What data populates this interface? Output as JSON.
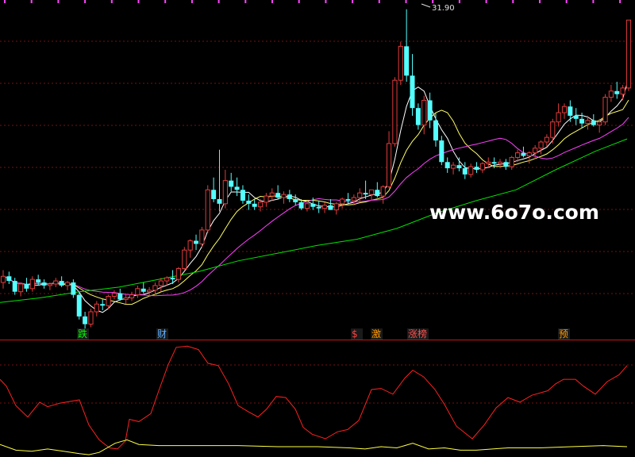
{
  "watermark": "www.6o7o.com",
  "colors": {
    "background": "#000000",
    "grid": "#7a1010",
    "separator": "#c01818",
    "up": "#e03c3c",
    "down": "#54ffff",
    "ma5": "#ffffff",
    "ma10": "#ffff66",
    "ma20": "#ff40ff",
    "ma60": "#00e400",
    "osc_red": "#ff2020",
    "osc_yellow": "#ffff40",
    "top_marks": "#ff44ff"
  },
  "tags": [
    {
      "id": "die",
      "text": "跌",
      "color": "#00ff00"
    },
    {
      "id": "cai",
      "text": "财",
      "color": "#60b0ff"
    },
    {
      "id": "dollar",
      "text": "$",
      "color": "#ff4040"
    },
    {
      "id": "ji",
      "text": "激",
      "color": "#ff9900"
    },
    {
      "id": "zhangbang",
      "text": "涨榜",
      "color": "#ff5050"
    },
    {
      "id": "yu",
      "text": "预",
      "color": "#ff9900"
    }
  ],
  "chart_data": [
    {
      "type": "candlestick",
      "title": "",
      "high_label": "31.90",
      "grid": true,
      "ylim": [
        10.5,
        32.5
      ],
      "candles": [
        [
          14.2,
          15.0,
          13.8,
          14.6
        ],
        [
          14.6,
          14.9,
          14.1,
          14.3
        ],
        [
          14.3,
          14.5,
          13.4,
          13.6
        ],
        [
          13.6,
          14.2,
          13.3,
          14.1
        ],
        [
          14.1,
          14.5,
          13.6,
          13.8
        ],
        [
          13.8,
          14.6,
          13.6,
          14.4
        ],
        [
          14.4,
          14.7,
          14.0,
          14.2
        ],
        [
          14.2,
          14.4,
          13.8,
          14.0
        ],
        [
          14.0,
          14.2,
          13.7,
          14.1
        ],
        [
          14.1,
          14.5,
          13.9,
          14.3
        ],
        [
          14.3,
          14.6,
          13.9,
          14.0
        ],
        [
          14.0,
          14.3,
          13.7,
          14.2
        ],
        [
          14.2,
          14.4,
          13.2,
          13.4
        ],
        [
          13.4,
          13.6,
          11.8,
          12.0
        ],
        [
          12.0,
          12.3,
          11.0,
          11.5
        ],
        [
          11.5,
          12.5,
          11.3,
          12.3
        ],
        [
          12.3,
          13.0,
          12.0,
          12.8
        ],
        [
          12.8,
          13.1,
          12.4,
          12.7
        ],
        [
          12.7,
          13.4,
          12.5,
          13.3
        ],
        [
          13.3,
          13.7,
          13.1,
          13.5
        ],
        [
          13.5,
          13.8,
          13.0,
          13.1
        ],
        [
          13.1,
          13.5,
          12.8,
          13.2
        ],
        [
          13.2,
          13.6,
          13.0,
          13.4
        ],
        [
          13.4,
          14.0,
          13.2,
          13.8
        ],
        [
          13.8,
          14.2,
          13.5,
          13.6
        ],
        [
          13.6,
          13.9,
          13.3,
          13.7
        ],
        [
          13.7,
          14.2,
          13.4,
          14.0
        ],
        [
          14.0,
          14.5,
          13.6,
          14.3
        ],
        [
          14.3,
          14.6,
          14.0,
          14.5
        ],
        [
          14.5,
          15.0,
          14.1,
          14.4
        ],
        [
          14.4,
          15.2,
          14.2,
          15.1
        ],
        [
          15.1,
          16.5,
          15.0,
          16.3
        ],
        [
          16.3,
          17.0,
          15.8,
          16.9
        ],
        [
          16.9,
          17.3,
          16.3,
          16.7
        ],
        [
          16.7,
          17.8,
          16.5,
          17.6
        ],
        [
          17.6,
          20.5,
          17.4,
          20.2
        ],
        [
          20.2,
          21.0,
          19.4,
          19.6
        ],
        [
          19.6,
          22.8,
          18.8,
          19.3
        ],
        [
          19.3,
          21.5,
          19.0,
          20.8
        ],
        [
          20.8,
          21.3,
          20.1,
          20.4
        ],
        [
          20.4,
          21.0,
          19.8,
          20.2
        ],
        [
          20.2,
          20.5,
          19.3,
          19.5
        ],
        [
          19.5,
          19.9,
          18.9,
          19.3
        ],
        [
          19.3,
          19.6,
          18.9,
          19.1
        ],
        [
          19.1,
          19.6,
          18.8,
          19.4
        ],
        [
          19.4,
          20.0,
          19.1,
          19.8
        ],
        [
          19.8,
          20.3,
          19.5,
          20.0
        ],
        [
          20.0,
          20.5,
          19.6,
          19.7
        ],
        [
          19.7,
          20.1,
          19.3,
          19.9
        ],
        [
          19.9,
          20.2,
          19.4,
          19.6
        ],
        [
          19.6,
          19.9,
          19.2,
          19.4
        ],
        [
          19.4,
          19.6,
          18.9,
          19.0
        ],
        [
          19.0,
          19.4,
          18.8,
          19.3
        ],
        [
          19.3,
          19.7,
          18.9,
          19.1
        ],
        [
          19.1,
          19.5,
          18.7,
          19.0
        ],
        [
          19.0,
          19.4,
          18.7,
          19.2
        ],
        [
          19.2,
          19.6,
          18.9,
          18.9
        ],
        [
          18.9,
          19.4,
          18.6,
          19.3
        ],
        [
          19.3,
          19.7,
          19.0,
          19.6
        ],
        [
          19.6,
          20.0,
          19.3,
          19.5
        ],
        [
          19.5,
          19.9,
          19.2,
          19.7
        ],
        [
          19.7,
          20.3,
          19.4,
          20.0
        ],
        [
          20.0,
          20.8,
          19.6,
          19.9
        ],
        [
          19.9,
          20.2,
          19.5,
          20.2
        ],
        [
          20.2,
          20.7,
          19.7,
          19.8
        ],
        [
          19.8,
          20.5,
          19.3,
          20.4
        ],
        [
          20.4,
          24.0,
          20.3,
          23.2
        ],
        [
          23.2,
          27.5,
          23.0,
          27.3
        ],
        [
          27.3,
          29.8,
          27.0,
          29.5
        ],
        [
          29.5,
          31.9,
          27.2,
          27.6
        ],
        [
          27.6,
          29.0,
          25.0,
          25.5
        ],
        [
          25.5,
          25.8,
          24.1,
          24.4
        ],
        [
          24.4,
          26.3,
          23.8,
          26.0
        ],
        [
          26.0,
          26.5,
          24.2,
          24.7
        ],
        [
          24.7,
          25.2,
          23.0,
          23.4
        ],
        [
          23.4,
          23.7,
          21.8,
          22.0
        ],
        [
          22.0,
          22.3,
          21.3,
          21.6
        ],
        [
          21.6,
          22.0,
          21.2,
          21.8
        ],
        [
          21.8,
          22.3,
          21.4,
          21.6
        ],
        [
          21.6,
          22.0,
          20.9,
          21.2
        ],
        [
          21.2,
          21.9,
          21.0,
          21.7
        ],
        [
          21.7,
          22.0,
          21.3,
          21.5
        ],
        [
          21.5,
          22.0,
          21.3,
          21.9
        ],
        [
          21.9,
          22.3,
          21.6,
          22.0
        ],
        [
          22.0,
          22.3,
          21.6,
          21.9
        ],
        [
          21.9,
          22.2,
          21.6,
          22.0
        ],
        [
          22.0,
          22.2,
          21.5,
          21.7
        ],
        [
          21.7,
          22.4,
          21.5,
          22.3
        ],
        [
          22.3,
          22.8,
          22.0,
          22.6
        ],
        [
          22.6,
          23.0,
          22.3,
          22.4
        ],
        [
          22.4,
          22.7,
          21.9,
          22.6
        ],
        [
          22.6,
          23.1,
          22.2,
          22.9
        ],
        [
          22.9,
          23.4,
          22.5,
          23.3
        ],
        [
          23.3,
          23.8,
          23.0,
          23.6
        ],
        [
          23.6,
          24.8,
          23.2,
          24.6
        ],
        [
          24.6,
          25.8,
          24.3,
          25.2
        ],
        [
          25.2,
          25.8,
          24.8,
          25.6
        ],
        [
          25.6,
          26.0,
          24.6,
          25.0
        ],
        [
          25.0,
          25.5,
          24.4,
          24.8
        ],
        [
          24.8,
          25.2,
          24.2,
          24.5
        ],
        [
          24.5,
          25.0,
          24.1,
          24.7
        ],
        [
          24.7,
          25.1,
          24.3,
          24.4
        ],
        [
          24.4,
          24.8,
          23.9,
          24.6
        ],
        [
          24.6,
          26.4,
          24.4,
          26.2
        ],
        [
          26.2,
          27.0,
          25.9,
          26.6
        ],
        [
          26.6,
          27.2,
          26.1,
          26.4
        ],
        [
          26.4,
          27.0,
          26.0,
          26.8
        ],
        [
          26.8,
          31.2,
          26.6,
          31.2
        ]
      ],
      "ma_periods": [
        5,
        10,
        20
      ],
      "ma60": [
        [
          0,
          12.9
        ],
        [
          50,
          13.2
        ],
        [
          100,
          13.6
        ],
        [
          150,
          13.9
        ],
        [
          200,
          14.4
        ],
        [
          250,
          14.9
        ],
        [
          300,
          15.6
        ],
        [
          350,
          16.1
        ],
        [
          400,
          16.6
        ],
        [
          450,
          17.0
        ],
        [
          500,
          17.7
        ],
        [
          550,
          18.7
        ],
        [
          600,
          19.5
        ],
        [
          650,
          20.2
        ],
        [
          700,
          21.5
        ],
        [
          750,
          22.7
        ],
        [
          790,
          23.5
        ]
      ]
    },
    {
      "type": "line",
      "title": "",
      "ylim": [
        0,
        100
      ],
      "series": [
        {
          "color": "#ff2020",
          "values": [
            [
              0,
              68
            ],
            [
              8,
              62
            ],
            [
              20,
              45
            ],
            [
              35,
              35
            ],
            [
              50,
              48
            ],
            [
              60,
              44
            ],
            [
              75,
              47
            ],
            [
              100,
              50
            ],
            [
              112,
              28
            ],
            [
              125,
              15
            ],
            [
              138,
              8
            ],
            [
              148,
              7
            ],
            [
              158,
              14
            ],
            [
              163,
              33
            ],
            [
              175,
              31
            ],
            [
              190,
              38
            ],
            [
              200,
              58
            ],
            [
              212,
              81
            ],
            [
              222,
              96
            ],
            [
              236,
              97
            ],
            [
              250,
              94
            ],
            [
              262,
              82
            ],
            [
              275,
              80
            ],
            [
              288,
              64
            ],
            [
              300,
              45
            ],
            [
              312,
              40
            ],
            [
              325,
              35
            ],
            [
              336,
              42
            ],
            [
              348,
              53
            ],
            [
              360,
              52
            ],
            [
              372,
              42
            ],
            [
              382,
              26
            ],
            [
              393,
              20
            ],
            [
              410,
              16
            ],
            [
              425,
              22
            ],
            [
              438,
              24
            ],
            [
              452,
              32
            ],
            [
              468,
              59
            ],
            [
              480,
              60
            ],
            [
              495,
              55
            ],
            [
              510,
              69
            ],
            [
              520,
              76
            ],
            [
              534,
              70
            ],
            [
              548,
              59
            ],
            [
              560,
              46
            ],
            [
              575,
              27
            ],
            [
              595,
              16
            ],
            [
              610,
              28
            ],
            [
              625,
              43
            ],
            [
              640,
              52
            ],
            [
              655,
              48
            ],
            [
              670,
              54
            ],
            [
              690,
              58
            ],
            [
              700,
              64
            ],
            [
              710,
              68
            ],
            [
              725,
              68
            ],
            [
              735,
              62
            ],
            [
              750,
              55
            ],
            [
              765,
              66
            ],
            [
              780,
              72
            ],
            [
              790,
              80
            ]
          ]
        },
        {
          "color": "#ffff40",
          "values": [
            [
              0,
              11
            ],
            [
              20,
              6
            ],
            [
              40,
              5
            ],
            [
              60,
              7
            ],
            [
              80,
              5
            ],
            [
              100,
              3
            ],
            [
              112,
              2
            ],
            [
              125,
              4
            ],
            [
              145,
              12
            ],
            [
              160,
              15
            ],
            [
              175,
              11
            ],
            [
              200,
              10
            ],
            [
              250,
              10
            ],
            [
              300,
              10
            ],
            [
              350,
              9
            ],
            [
              400,
              9
            ],
            [
              440,
              8
            ],
            [
              460,
              7
            ],
            [
              480,
              9
            ],
            [
              500,
              8
            ],
            [
              520,
              12
            ],
            [
              540,
              7
            ],
            [
              560,
              8
            ],
            [
              580,
              6
            ],
            [
              600,
              6
            ],
            [
              640,
              8
            ],
            [
              680,
              8
            ],
            [
              720,
              9
            ],
            [
              760,
              10
            ],
            [
              790,
              9
            ]
          ]
        }
      ]
    }
  ]
}
